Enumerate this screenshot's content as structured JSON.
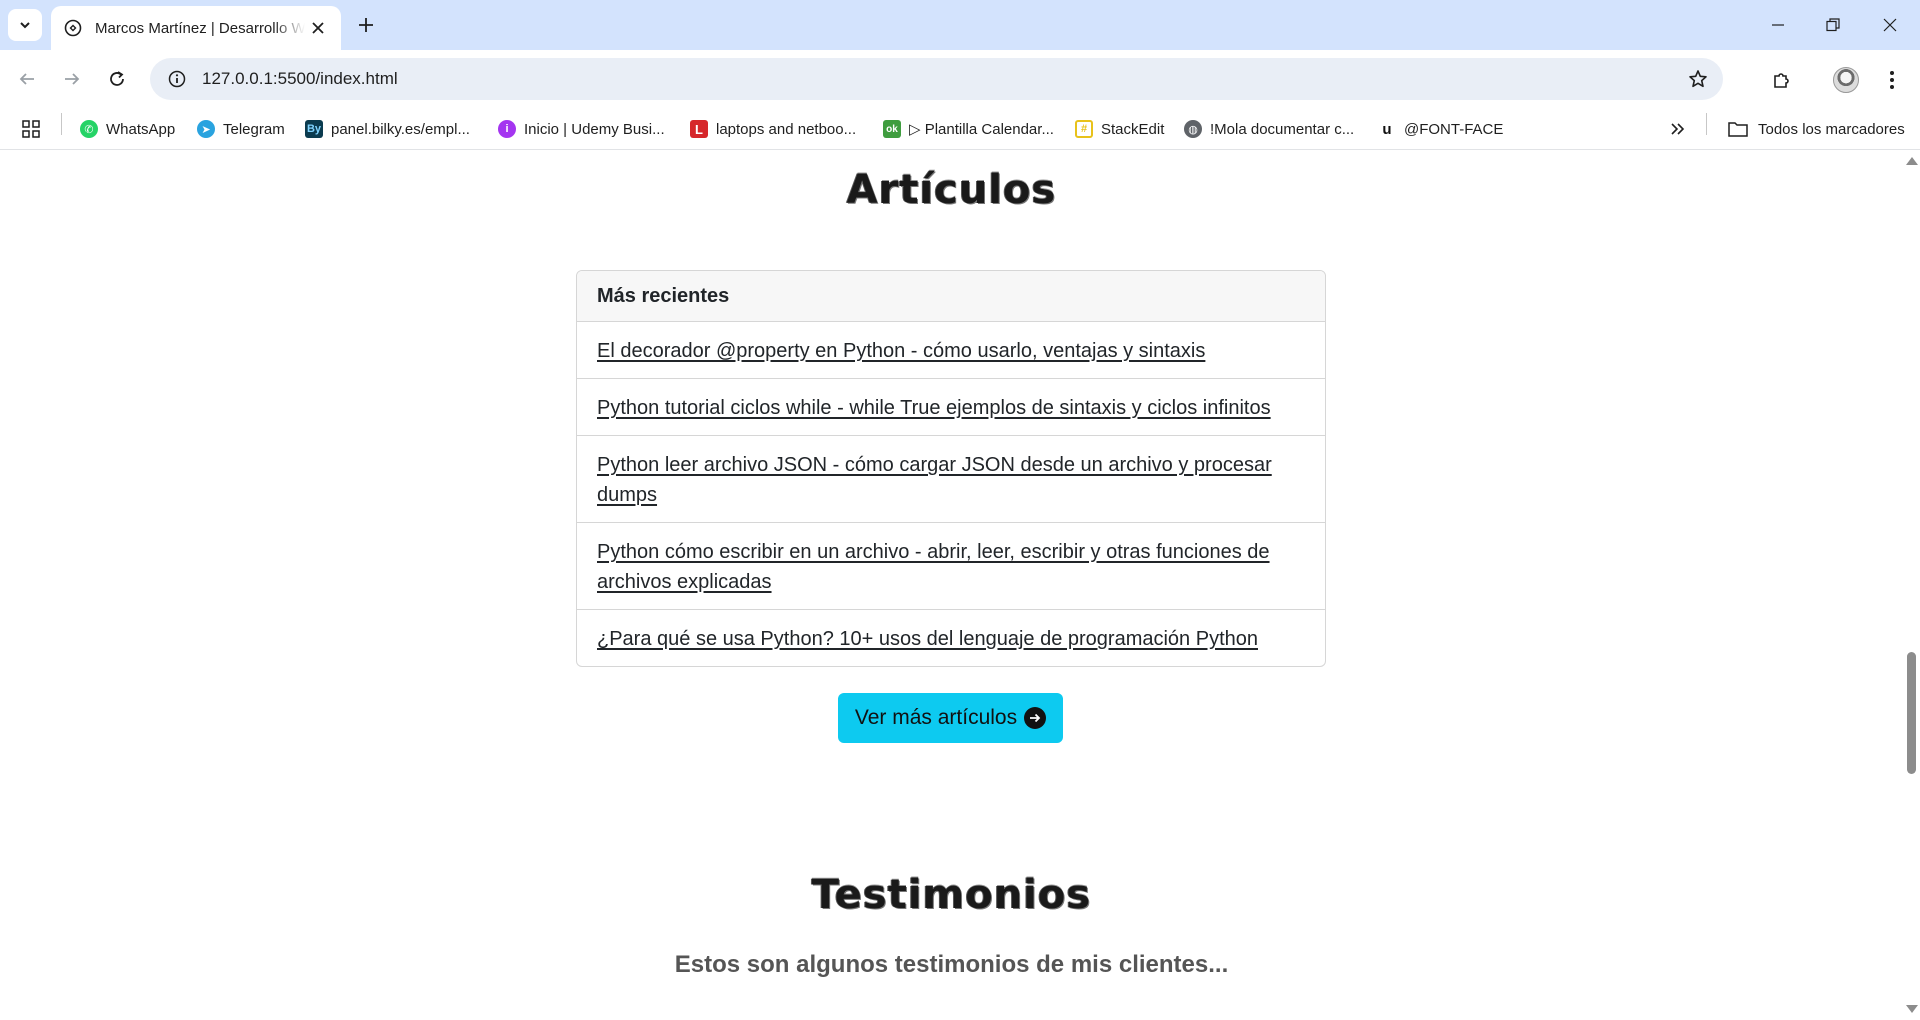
{
  "browser": {
    "tab_title": "Marcos Martínez | Desarrollo Web",
    "url": "127.0.0.1:5500/index.html",
    "bookmarks": [
      {
        "label": "WhatsApp",
        "icon": "whatsapp-icon",
        "color": "#25d366"
      },
      {
        "label": "Telegram",
        "icon": "telegram-icon",
        "color": "#2aa3df"
      },
      {
        "label": "panel.bilky.es/empl...",
        "icon": "bilky-icon",
        "color": "#0b3b4f"
      },
      {
        "label": "Inicio | Udemy Busi...",
        "icon": "udemy-icon",
        "color": "#a435f0"
      },
      {
        "label": "laptops and netboo...",
        "icon": "l-icon",
        "color": "#d6272b"
      },
      {
        "label": "▷ Plantilla Calendar...",
        "icon": "ok-icon",
        "color": "#3f9d3f"
      },
      {
        "label": "StackEdit",
        "icon": "stackedit-icon",
        "color": "#e8c21b"
      },
      {
        "label": "!Mola documentar c...",
        "icon": "globe-icon",
        "color": "#5f6368"
      },
      {
        "label": "@FONT-FACE",
        "icon": "u-icon",
        "color": "#111111"
      }
    ],
    "all_bookmarks_label": "Todos los marcadores"
  },
  "articles": {
    "title": "Artículos",
    "card_header": "Más recientes",
    "items": [
      {
        "text": "El decorador @property en Python - cómo usarlo, ventajas y sintaxis"
      },
      {
        "text": "Python tutorial ciclos while - while True ejemplos de sintaxis y ciclos infinitos"
      },
      {
        "text": "Python leer archivo JSON - cómo cargar JSON desde un archivo y procesar dumps"
      },
      {
        "text": "Python cómo escribir en un archivo - abrir, leer, escribir y otras funciones de archivos explicadas"
      },
      {
        "text": "¿Para qué se usa Python? 10+ usos del lenguaje de programación Python"
      }
    ],
    "more_button": "Ver más artículos"
  },
  "testimonials": {
    "title": "Testimonios",
    "subtitle": "Estos son algunos testimonios de mis clientes..."
  },
  "colors": {
    "accent_button": "#0dcaf0",
    "tabstrip": "#d3e3fd"
  }
}
